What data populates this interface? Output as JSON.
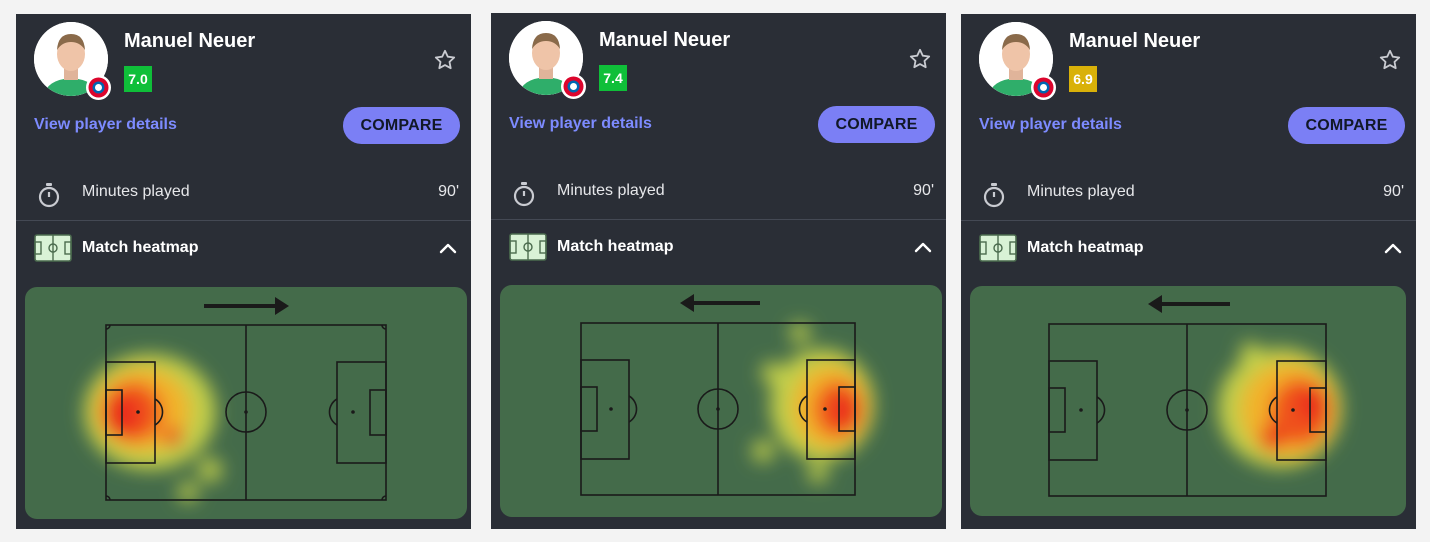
{
  "cards": [
    {
      "player_name": "Manuel Neuer",
      "rating": "7.0",
      "rating_color": "#0fbf39",
      "view_details_label": "View player details",
      "compare_label": "COMPARE",
      "minutes_label": "Minutes played",
      "minutes_value": "90'",
      "heatmap_title": "Match heatmap",
      "attack_direction": "right"
    },
    {
      "player_name": "Manuel Neuer",
      "rating": "7.4",
      "rating_color": "#0fbf39",
      "view_details_label": "View player details",
      "compare_label": "COMPARE",
      "minutes_label": "Minutes played",
      "minutes_value": "90'",
      "heatmap_title": "Match heatmap",
      "attack_direction": "left"
    },
    {
      "player_name": "Manuel Neuer",
      "rating": "6.9",
      "rating_color": "#d9b109",
      "view_details_label": "View player details",
      "compare_label": "COMPARE",
      "minutes_label": "Minutes played",
      "minutes_value": "90'",
      "heatmap_title": "Match heatmap",
      "attack_direction": "left"
    }
  ],
  "icons": {
    "favorite": "star-outline-icon",
    "minutes": "stopwatch-icon",
    "heatmap": "pitch-icon",
    "collapse": "chevron-up-icon",
    "direction": "arrow-icon"
  }
}
